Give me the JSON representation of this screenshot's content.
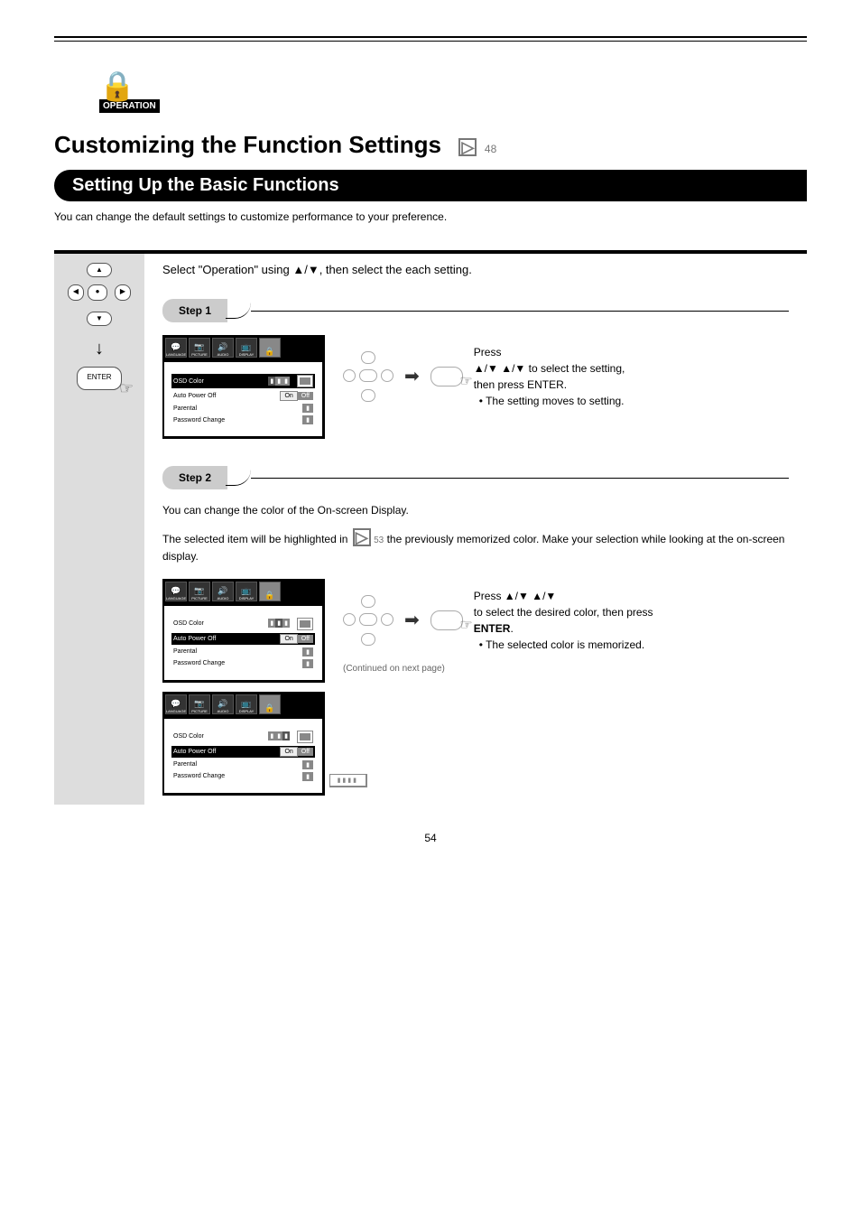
{
  "op_badge": "OPERATION",
  "title_main": "Customizing the Function Settings",
  "title_note": "48",
  "setting_bar": "Setting Up the Basic Functions",
  "intro": "You can change the default settings to customize performance to your preference.",
  "step_label": "Step",
  "step1_head": "Select \"Operation\" using ▲/▼, then select the each setting.",
  "step1": {
    "line1": "Press",
    "line2_a": "▲/▼ to select the setting,",
    "line2_b": "then press ENTER.",
    "line3": "• The setting moves to setting."
  },
  "step2_text": {
    "p1": "You can change the color of the On-screen Display.",
    "p2_a": "The selected item will be highlighted in ",
    "p2_goto": "53",
    "p2_b": "the previously memorized color. Make your selection while looking at the on-screen display."
  },
  "step2_instr": {
    "l1_a": "Press ▲/▼ ",
    "l1_b": "to select the desired color, then press",
    "l1_c": "ENTER",
    "l2": "• The selected color is memorized."
  },
  "menu_tabs": {
    "t1": "LANGUAGE",
    "t2": "PICTURE",
    "t3": "AUDIO",
    "t4": "DISPLAY",
    "t5": ""
  },
  "menu1": {
    "r1": {
      "label": "OSD Color",
      "val_on": "",
      "seg": [
        "",
        "",
        ""
      ]
    },
    "r2": {
      "label": "Auto Power Off",
      "on": "On",
      "off": "Off"
    },
    "r3": {
      "label": "Parental"
    },
    "r4": {
      "label": "Password Change"
    }
  },
  "menu2": {
    "r1": {
      "label": "OSD Color"
    },
    "r2": {
      "label": "Auto Power Off",
      "on": "On",
      "off": "Off"
    },
    "r3": {
      "label": "Parental"
    },
    "r4": {
      "label": "Password Change"
    }
  },
  "menu3": {
    "r1": {
      "label": "OSD Color"
    },
    "r2": {
      "label": "Auto Power Off",
      "on": "On",
      "off": "Off"
    },
    "r3": {
      "label": "Parental"
    },
    "r4": {
      "label": "Password Change"
    },
    "pass": "▮▮▮▮"
  },
  "cont": "(Continued on next page)",
  "pgnum": "54",
  "triangles": "▲/▼"
}
